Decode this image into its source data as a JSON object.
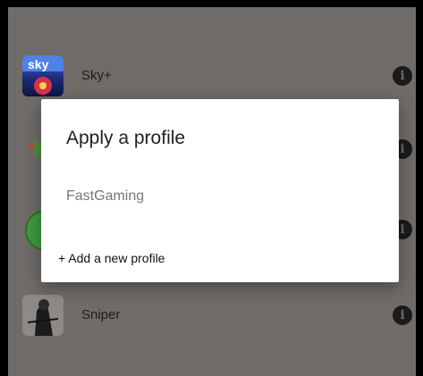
{
  "apps": [
    {
      "label": "Sky+",
      "icon": "sky-app-icon"
    },
    {
      "label": "",
      "icon": "green-app-icon"
    },
    {
      "label": "",
      "icon": "globe-app-icon"
    },
    {
      "label": "Sniper",
      "icon": "sniper-app-icon"
    }
  ],
  "dialog": {
    "title": "Apply a profile",
    "profiles": [
      "FastGaming"
    ],
    "add_label": "+ Add a new profile"
  },
  "icons": {
    "info": "info-icon"
  },
  "colors": {
    "scrim_background": "#6f6b68",
    "dialog_background": "#ffffff",
    "info_icon": "#1a1a1a"
  }
}
